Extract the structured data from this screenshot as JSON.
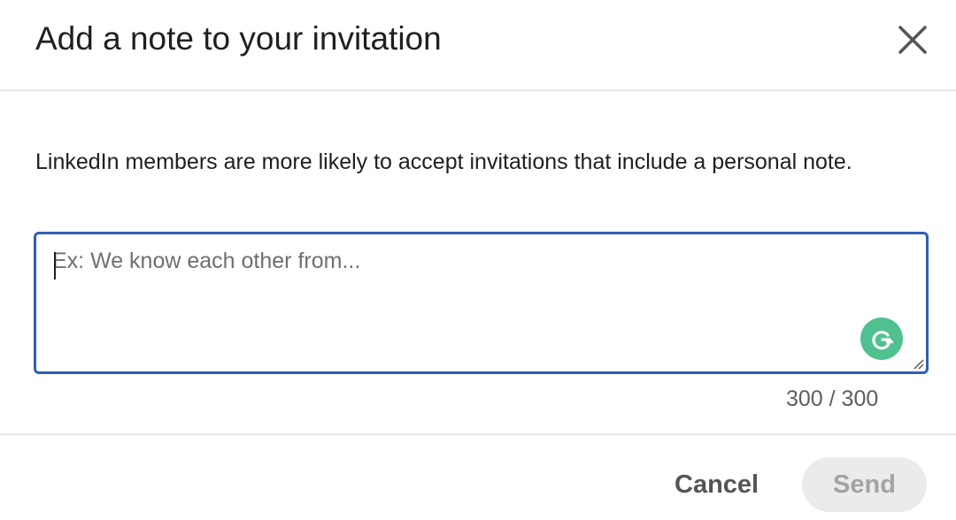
{
  "dialog": {
    "title": "Add a note to your invitation",
    "close_icon": "close-icon",
    "description": "LinkedIn members are more likely to accept invitations that include a personal note.",
    "note": {
      "placeholder": "Ex: We know each other from...",
      "value": "",
      "grammarly_icon": "grammarly-icon",
      "counter": "300 / 300"
    },
    "actions": {
      "cancel_label": "Cancel",
      "send_label": "Send",
      "send_enabled": false
    },
    "colors": {
      "focus_border": "#2f5eb8",
      "grammarly": "#4fc18f",
      "send_disabled_bg": "#ebebeb"
    }
  }
}
